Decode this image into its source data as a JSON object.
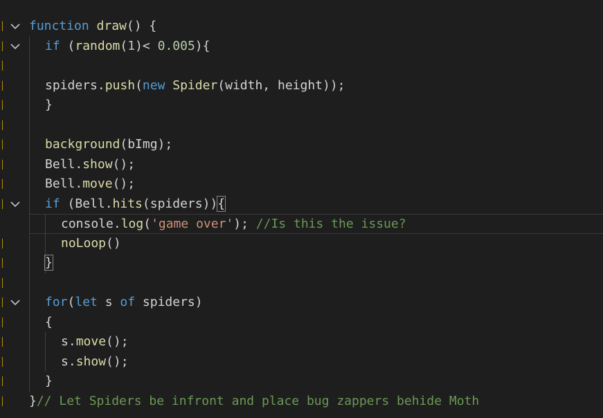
{
  "editor": {
    "lines": [
      {
        "indent": 0,
        "fold": true,
        "tokens": [
          {
            "t": "function",
            "c": "kw"
          },
          {
            "t": " draw",
            "c": "fn"
          },
          {
            "t": "() {",
            "c": "id"
          }
        ]
      },
      {
        "indent": 1,
        "fold": true,
        "tokens": [
          {
            "t": "if",
            "c": "kw"
          },
          {
            "t": " (",
            "c": "id"
          },
          {
            "t": "random",
            "c": "fn"
          },
          {
            "t": "(",
            "c": "id"
          },
          {
            "t": "1",
            "c": "num"
          },
          {
            "t": ")< ",
            "c": "id"
          },
          {
            "t": "0.005",
            "c": "num"
          },
          {
            "t": "){",
            "c": "id"
          }
        ]
      },
      {
        "indent": 1,
        "fold": false,
        "tokens": []
      },
      {
        "indent": 1,
        "fold": false,
        "tokens": [
          {
            "t": "spiders",
            "c": "id"
          },
          {
            "t": ".",
            "c": "id"
          },
          {
            "t": "push",
            "c": "fn"
          },
          {
            "t": "(",
            "c": "id"
          },
          {
            "t": "new",
            "c": "kw"
          },
          {
            "t": " Spider",
            "c": "fn"
          },
          {
            "t": "(width, height));",
            "c": "id"
          }
        ]
      },
      {
        "indent": 1,
        "fold": false,
        "tokens": [
          {
            "t": "}",
            "c": "id"
          }
        ]
      },
      {
        "indent": 1,
        "fold": false,
        "tokens": []
      },
      {
        "indent": 1,
        "fold": false,
        "tokens": [
          {
            "t": "background",
            "c": "fn"
          },
          {
            "t": "(bImg);",
            "c": "id"
          }
        ]
      },
      {
        "indent": 1,
        "fold": false,
        "tokens": [
          {
            "t": "Bell",
            "c": "id"
          },
          {
            "t": ".",
            "c": "id"
          },
          {
            "t": "show",
            "c": "fn"
          },
          {
            "t": "();",
            "c": "id"
          }
        ]
      },
      {
        "indent": 1,
        "fold": false,
        "tokens": [
          {
            "t": "Bell",
            "c": "id"
          },
          {
            "t": ".",
            "c": "id"
          },
          {
            "t": "move",
            "c": "fn"
          },
          {
            "t": "();",
            "c": "id"
          }
        ]
      },
      {
        "indent": 1,
        "fold": true,
        "tokens": [
          {
            "t": "if",
            "c": "kw"
          },
          {
            "t": " (Bell.",
            "c": "id"
          },
          {
            "t": "hits",
            "c": "fn"
          },
          {
            "t": "(spiders))",
            "c": "id"
          },
          {
            "t": "{",
            "c": "id",
            "box": true
          }
        ]
      },
      {
        "indent": 2,
        "fold": false,
        "current": true,
        "tokens": [
          {
            "t": "console",
            "c": "id"
          },
          {
            "t": ".",
            "c": "id"
          },
          {
            "t": "log",
            "c": "fn"
          },
          {
            "t": "(",
            "c": "id"
          },
          {
            "t": "'game over'",
            "c": "str"
          },
          {
            "t": "); ",
            "c": "id"
          },
          {
            "t": "//Is this the issue?",
            "c": "cm"
          }
        ]
      },
      {
        "indent": 2,
        "fold": false,
        "tokens": [
          {
            "t": "noLoop",
            "c": "fn"
          },
          {
            "t": "()",
            "c": "id"
          }
        ]
      },
      {
        "indent": 1,
        "fold": false,
        "tokens": [
          {
            "t": "}",
            "c": "id",
            "box": true
          }
        ]
      },
      {
        "indent": 1,
        "fold": false,
        "tokens": []
      },
      {
        "indent": 1,
        "fold": true,
        "tokens": [
          {
            "t": "for",
            "c": "kw"
          },
          {
            "t": "(",
            "c": "id"
          },
          {
            "t": "let",
            "c": "kw"
          },
          {
            "t": " s ",
            "c": "id"
          },
          {
            "t": "of",
            "c": "kw"
          },
          {
            "t": " spiders)",
            "c": "id"
          }
        ]
      },
      {
        "indent": 1,
        "fold": false,
        "tokens": [
          {
            "t": "{",
            "c": "id"
          }
        ]
      },
      {
        "indent": 2,
        "fold": false,
        "tokens": [
          {
            "t": "s",
            "c": "id"
          },
          {
            "t": ".",
            "c": "id"
          },
          {
            "t": "move",
            "c": "fn"
          },
          {
            "t": "();",
            "c": "id"
          }
        ]
      },
      {
        "indent": 2,
        "fold": false,
        "tokens": [
          {
            "t": "s",
            "c": "id"
          },
          {
            "t": ".",
            "c": "id"
          },
          {
            "t": "show",
            "c": "fn"
          },
          {
            "t": "();",
            "c": "id"
          }
        ]
      },
      {
        "indent": 1,
        "fold": false,
        "tokens": [
          {
            "t": "}",
            "c": "id"
          }
        ]
      },
      {
        "indent": 0,
        "fold": false,
        "tokens": [
          {
            "t": "}",
            "c": "id"
          },
          {
            "t": "// Let Spiders be infront and place bug zappers behide Moth",
            "c": "cm"
          }
        ]
      }
    ]
  },
  "icons": {
    "fold": "chevron-down-icon"
  },
  "colors": {
    "background": "#1e1e1e",
    "keyword": "#569cd6",
    "function": "#dcdcaa",
    "identifier": "#d4d4d4",
    "number": "#b5cea8",
    "string": "#ce9178",
    "comment": "#6a9955"
  }
}
